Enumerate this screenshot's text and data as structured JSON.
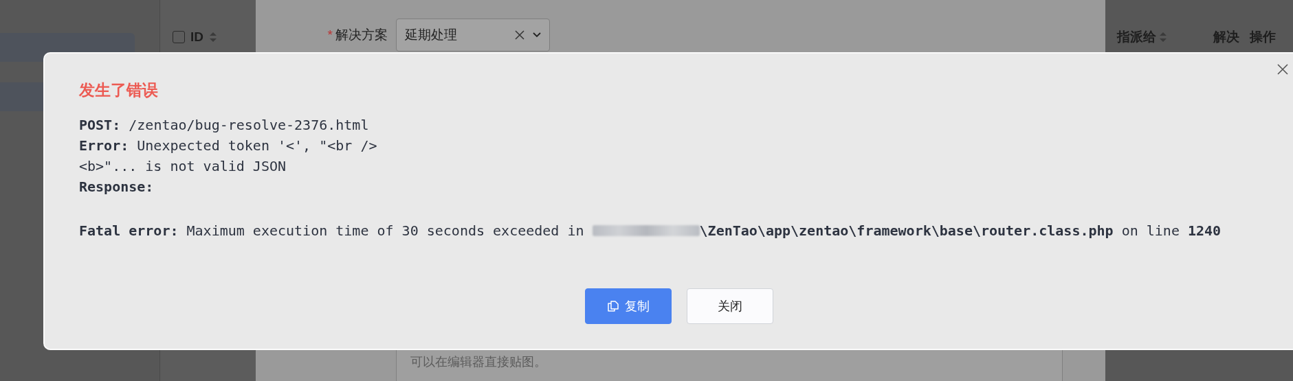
{
  "backdrop": {
    "table_left": {
      "select_all": {
        "checked": false
      },
      "header": {
        "label": "ID",
        "sortable": true
      }
    },
    "form": {
      "label": "解决方案",
      "required_mark": "*",
      "select_value": "延期处理",
      "editor_placeholder": "可以在编辑器直接贴图。"
    },
    "table_right": {
      "columns": [
        {
          "label": "指派给",
          "sortable": true
        },
        {
          "label": "解决",
          "sortable": false
        },
        {
          "label": "操作",
          "sortable": false
        }
      ]
    }
  },
  "dialog": {
    "title": "发生了错误",
    "lines": [
      "**POST:** /zentao/bug-resolve-2376.html",
      "**Error:** Unexpected token '<', \"<br />",
      "<b>\"... is not valid JSON",
      "**Response:**"
    ],
    "fatal": {
      "before": "**Fatal error:** Maximum execution time of 30 seconds exceeded in ",
      "after": "**\\ZenTao\\app\\zentao\\framework\\base\\router.class.php** on line **1240**"
    },
    "buttons": [
      {
        "label": "复制",
        "kind": "primary"
      },
      {
        "label": "关闭",
        "kind": "default"
      }
    ]
  }
}
